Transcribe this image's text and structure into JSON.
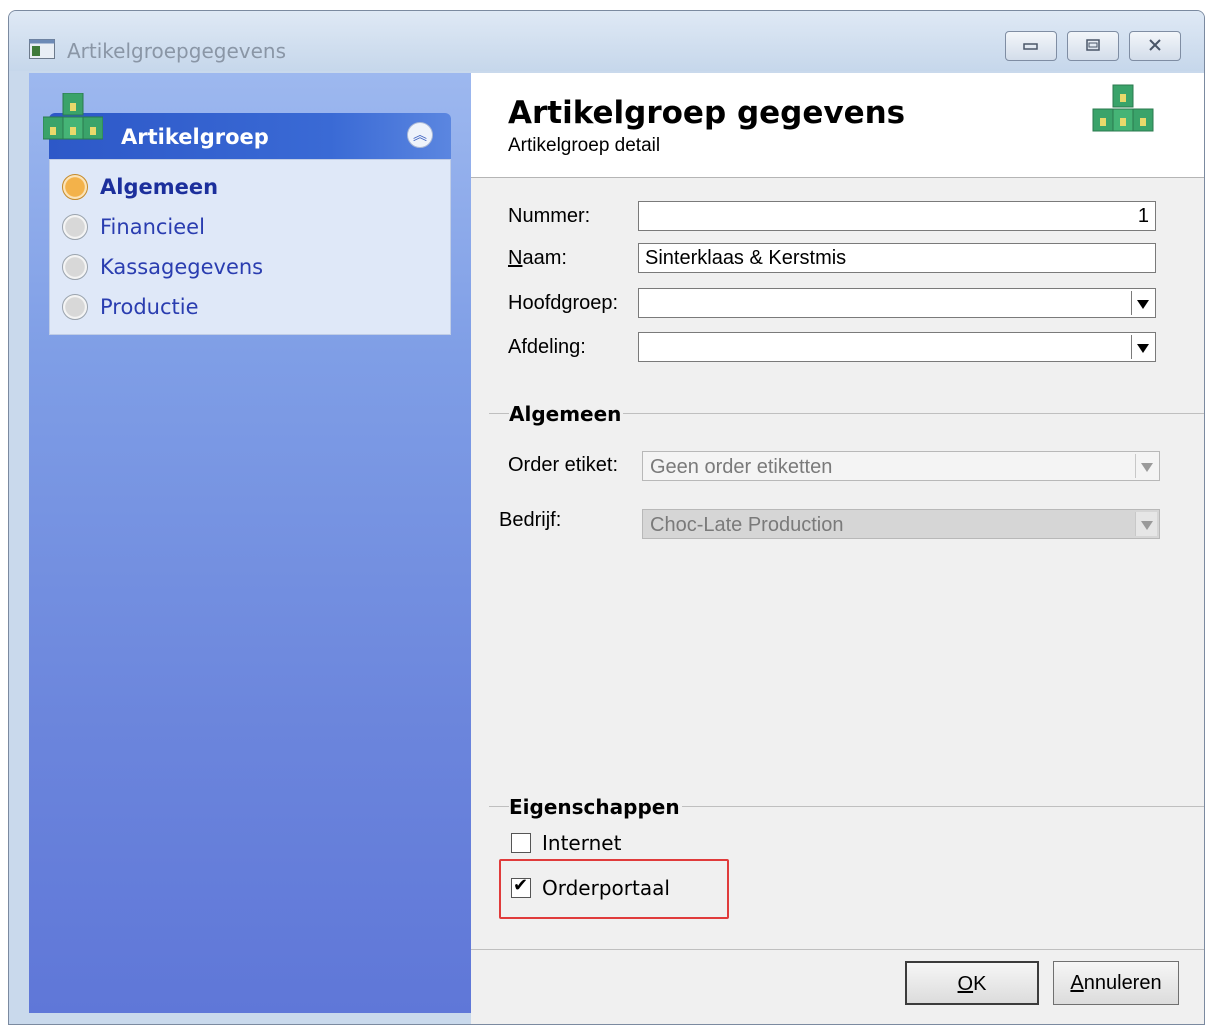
{
  "window": {
    "title": "Artikelgroepgegevens",
    "controls": [
      "minimize",
      "maximize",
      "close"
    ]
  },
  "sidebar": {
    "group_title": "Artikelgroep",
    "items": [
      {
        "label": "Algemeen",
        "active": true
      },
      {
        "label": "Financieel",
        "active": false
      },
      {
        "label": "Kassagegevens",
        "active": false
      },
      {
        "label": "Productie",
        "active": false
      }
    ]
  },
  "header": {
    "title": "Artikelgroep gegevens",
    "subtitle": "Artikelgroep detail",
    "icon": "boxes-icon"
  },
  "form": {
    "nummer": {
      "label": "Nummer:",
      "value": "1"
    },
    "naam": {
      "label": "Naam:",
      "value": "Sinterklaas & Kerstmis"
    },
    "hoofdgroep": {
      "label": "Hoofdgroep:",
      "value": ""
    },
    "afdeling": {
      "label": "Afdeling:",
      "value": ""
    }
  },
  "algemeen": {
    "title": "Algemeen",
    "order_etiket": {
      "label": "Order etiket:",
      "value": "Geen order etiketten"
    },
    "bedrijf": {
      "label": "Bedrijf:",
      "value": "Choc-Late Production"
    }
  },
  "eigenschappen": {
    "title": "Eigenschappen",
    "internet": {
      "label": "Internet",
      "checked": false
    },
    "orderportaal": {
      "label": "Orderportaal",
      "checked": true
    }
  },
  "buttons": {
    "ok": "OK",
    "cancel": "Annuleren"
  },
  "colors": {
    "highlight": "#e03b3b",
    "sidebar_header": "#2d58c8",
    "sidebar_bg": "#6b85dc"
  }
}
